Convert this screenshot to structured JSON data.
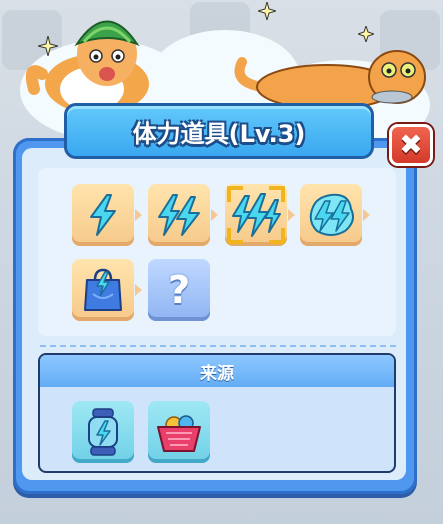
{
  "dialog": {
    "title": "体力道具(Lv.3)",
    "close_label": "✖",
    "close_icon": "close-icon"
  },
  "items": [
    {
      "name": "energy-lv1",
      "icon": "lightning-bolt-single-icon",
      "state": "discovered"
    },
    {
      "name": "energy-lv2",
      "icon": "lightning-bolt-double-icon",
      "state": "discovered"
    },
    {
      "name": "energy-lv3",
      "icon": "lightning-bolt-triple-icon",
      "state": "selected"
    },
    {
      "name": "energy-lv4",
      "icon": "lightning-bolt-cluster-icon",
      "state": "discovered"
    },
    {
      "name": "energy-lv5",
      "icon": "lightning-gift-bag-icon",
      "state": "discovered"
    },
    {
      "name": "energy-lv6",
      "icon": "question-mark-icon",
      "state": "unknown",
      "label": "?"
    }
  ],
  "source": {
    "title": "来源",
    "items": [
      {
        "name": "energy-lantern",
        "icon": "lightning-lantern-icon"
      },
      {
        "name": "energy-basket",
        "icon": "basket-icon"
      }
    ]
  },
  "colors": {
    "panel": "#4f97ef",
    "title_banner": "#3aa8f0",
    "close_button": "#d4392a",
    "item_slot": "#f6c98a",
    "unknown_slot": "#8fb4f2",
    "source_slot": "#6fd0e6",
    "selector": "#f0b41e",
    "lightning": "#2ec7e6"
  }
}
